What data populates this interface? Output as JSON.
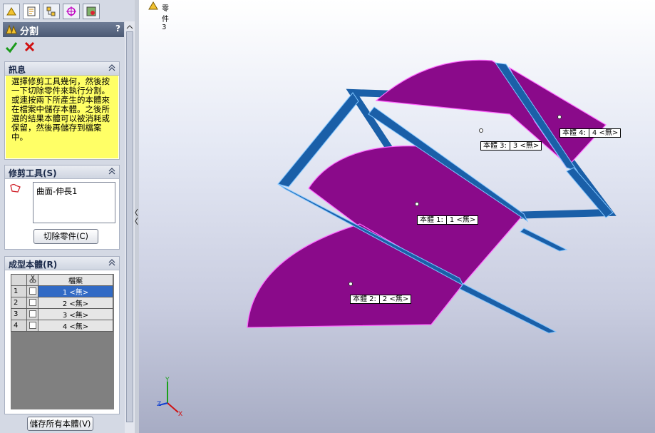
{
  "tabs": [
    {
      "icon": "feature-manager-icon"
    },
    {
      "icon": "property-manager-icon"
    },
    {
      "icon": "configuration-manager-icon"
    },
    {
      "icon": "dimxpert-icon"
    },
    {
      "icon": "display-manager-icon"
    }
  ],
  "feature": {
    "title": "分割",
    "help": "?"
  },
  "actions": {
    "ok_icon": "checkmark-icon",
    "cancel_icon": "close-icon"
  },
  "message": {
    "header": "訊息",
    "text": "選擇修剪工具幾何，然後按一下切除零件來執行分割。或連按兩下所產生的本體來在檔案中儲存本體。之後所選的結果本體可以被消耗或保留，然後再儲存到檔案中。"
  },
  "trim_tools": {
    "header": "修剪工具(S)",
    "items": [
      "曲面-伸長1"
    ],
    "cut_button": "切除零件(C)"
  },
  "bodies": {
    "header": "成型本體(R)",
    "columns": [
      "",
      "",
      "檔案"
    ],
    "rows": [
      {
        "num": "1",
        "file": "1 <無>"
      },
      {
        "num": "2",
        "file": "2 <無>"
      },
      {
        "num": "3",
        "file": "3 <無>"
      },
      {
        "num": "4",
        "file": "4 <無>"
      }
    ],
    "save_all_button": "儲存所有本體(V)"
  },
  "viewport": {
    "part_name": "零件3",
    "body_labels": [
      {
        "name": "本體 1:",
        "value": "1 <無>"
      },
      {
        "name": "本體 2:",
        "value": "2 <無>"
      },
      {
        "name": "本體 3:",
        "value": "3 <無>"
      },
      {
        "name": "本體 4:",
        "value": "4 <無>"
      }
    ],
    "axes": {
      "x": "X",
      "y": "Y",
      "z": "Z"
    }
  },
  "colors": {
    "body": "#8a0a8a",
    "edge": "#ff66ff",
    "plane": "#1a5fa8",
    "plane_edge": "#7fc4ff",
    "message_bg": "#ffff66"
  }
}
